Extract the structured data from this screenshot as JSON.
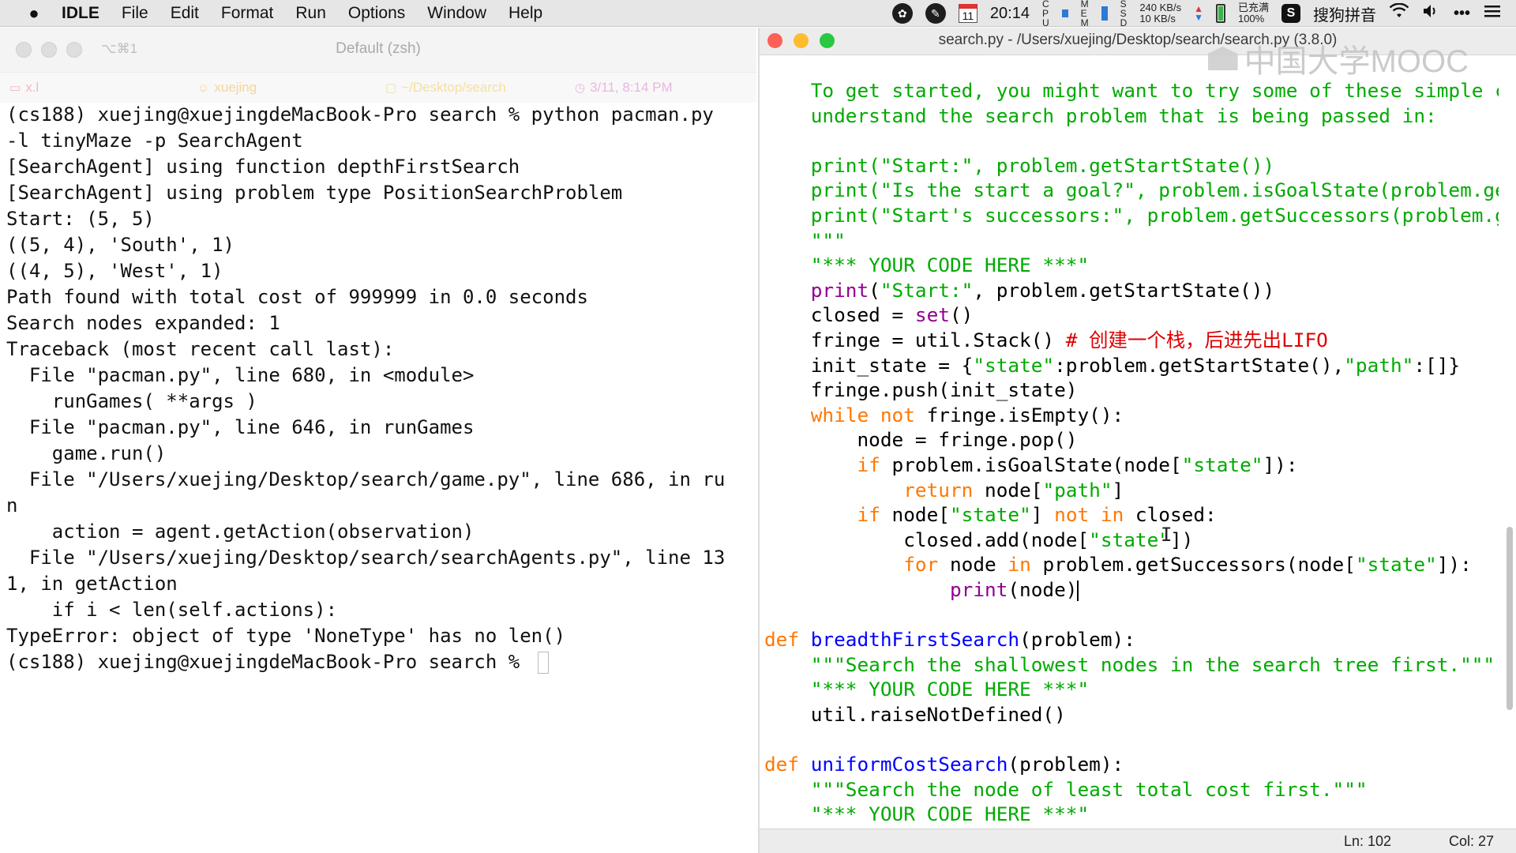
{
  "menubar": {
    "apple_icon": "apple-icon",
    "app_name": "IDLE",
    "items": [
      "File",
      "Edit",
      "Format",
      "Run",
      "Options",
      "Window",
      "Help"
    ],
    "status": {
      "calendar_day": "11",
      "time": "20:14",
      "cpu_labels": [
        "C",
        "P",
        "U"
      ],
      "mem_labels": [
        "M",
        "E",
        "M"
      ],
      "ssd_labels": [
        "S",
        "S",
        "D"
      ],
      "net_up": "240 KB/s",
      "net_down": "10 KB/s",
      "battery_status": "已充满",
      "battery_percent": "100%",
      "ime_name": "搜狗拼音"
    }
  },
  "terminal": {
    "shortcut": "⌥⌘1",
    "title": "Default (zsh)",
    "info": {
      "tab": "x.l",
      "user": "xuejing",
      "dir": "~/Desktop/search",
      "time": "3/11, 8:14 PM"
    },
    "lines": [
      "(cs188) xuejing@xuejingdeMacBook-Pro search % python pacman.py",
      "-l tinyMaze -p SearchAgent",
      "[SearchAgent] using function depthFirstSearch",
      "[SearchAgent] using problem type PositionSearchProblem",
      "Start: (5, 5)",
      "((5, 4), 'South', 1)",
      "((4, 5), 'West', 1)",
      "Path found with total cost of 999999 in 0.0 seconds",
      "Search nodes expanded: 1",
      "Traceback (most recent call last):",
      "  File \"pacman.py\", line 680, in <module>",
      "    runGames( **args )",
      "  File \"pacman.py\", line 646, in runGames",
      "    game.run()",
      "  File \"/Users/xuejing/Desktop/search/game.py\", line 686, in ru",
      "n",
      "    action = agent.getAction(observation)",
      "  File \"/Users/xuejing/Desktop/search/searchAgents.py\", line 13",
      "1, in getAction",
      "    if i < len(self.actions):",
      "TypeError: object of type 'NoneType' has no len()"
    ],
    "prompt": "(cs188) xuejing@xuejingdeMacBook-Pro search % "
  },
  "idle": {
    "title": "search.py - /Users/xuejing/Desktop/search/search.py (3.8.0)",
    "watermark": "中国大学MOOC",
    "code_lines": [
      [
        [
          "s",
          "    To get started, you might want to try some of these simple commands to"
        ]
      ],
      [
        [
          "s",
          "    understand the search problem that is being passed in:"
        ]
      ],
      [],
      [
        [
          "s",
          "    print(\"Start:\", problem.getStartState())"
        ]
      ],
      [
        [
          "s",
          "    print(\"Is the start a goal?\", problem.isGoalState(problem.getStartState()))"
        ]
      ],
      [
        [
          "s",
          "    print(\"Start's successors:\", problem.getSuccessors(problem.getStartState()))"
        ]
      ],
      [
        [
          "s",
          "    \"\"\""
        ]
      ],
      [
        [
          "s",
          "    \"*** YOUR CODE HERE ***\""
        ]
      ],
      [
        [
          "b",
          "    print"
        ],
        [
          "n",
          "("
        ],
        [
          "s",
          "\"Start:\""
        ],
        [
          "n",
          ", problem.getStartState())"
        ]
      ],
      [
        [
          "n",
          "    closed = "
        ],
        [
          "b",
          "set"
        ],
        [
          "n",
          "()"
        ]
      ],
      [
        [
          "n",
          "    fringe = util.Stack() "
        ],
        [
          "c",
          "# 创建一个栈，后进先出LIFO"
        ]
      ],
      [
        [
          "n",
          "    init_state = {"
        ],
        [
          "s",
          "\"state\""
        ],
        [
          "n",
          ":problem.getStartState(),"
        ],
        [
          "s",
          "\"path\""
        ],
        [
          "n",
          ":[]}"
        ]
      ],
      [
        [
          "n",
          "    fringe.push(init_state)"
        ]
      ],
      [
        [
          "k",
          "    while not"
        ],
        [
          "n",
          " fringe.isEmpty():"
        ]
      ],
      [
        [
          "n",
          "        node = fringe.pop()"
        ]
      ],
      [
        [
          "k",
          "        if"
        ],
        [
          "n",
          " problem.isGoalState(node["
        ],
        [
          "s",
          "\"state\""
        ],
        [
          "n",
          "]):"
        ]
      ],
      [
        [
          "k",
          "            return"
        ],
        [
          "n",
          " node["
        ],
        [
          "s",
          "\"path\""
        ],
        [
          "n",
          "]"
        ]
      ],
      [
        [
          "k",
          "        if"
        ],
        [
          "n",
          " node["
        ],
        [
          "s",
          "\"state\""
        ],
        [
          "n",
          "] "
        ],
        [
          "k",
          "not in"
        ],
        [
          "n",
          " closed:"
        ]
      ],
      [
        [
          "n",
          "            closed.add(node["
        ],
        [
          "s",
          "\"state\""
        ],
        [
          "n",
          "])"
        ]
      ],
      [
        [
          "k",
          "            for"
        ],
        [
          "n",
          " node "
        ],
        [
          "k",
          "in"
        ],
        [
          "n",
          " problem.getSuccessors(node["
        ],
        [
          "s",
          "\"state\""
        ],
        [
          "n",
          "]):"
        ]
      ],
      [
        [
          "b",
          "                print"
        ],
        [
          "n",
          "(node)"
        ],
        [
          "cursor",
          ""
        ]
      ],
      [],
      [
        [
          "k",
          "def "
        ],
        [
          "d",
          "breadthFirstSearch"
        ],
        [
          "n",
          "(problem):"
        ]
      ],
      [
        [
          "s",
          "    \"\"\"Search the shallowest nodes in the search tree first.\"\"\""
        ]
      ],
      [
        [
          "s",
          "    \"*** YOUR CODE HERE ***\""
        ]
      ],
      [
        [
          "n",
          "    util.raiseNotDefined()"
        ]
      ],
      [],
      [
        [
          "k",
          "def "
        ],
        [
          "d",
          "uniformCostSearch"
        ],
        [
          "n",
          "(problem):"
        ]
      ],
      [
        [
          "s",
          "    \"\"\"Search the node of least total cost first.\"\"\""
        ]
      ],
      [
        [
          "s",
          "    \"*** YOUR CODE HERE ***\""
        ]
      ],
      [
        [
          "n",
          "    util.raiseNotDefined()"
        ]
      ]
    ],
    "status": {
      "line": "Ln: 102",
      "col": "Col: 27"
    }
  },
  "colors": {
    "string": "#00aa00",
    "keyword": "#ff7700",
    "definition": "#0000ff",
    "builtin": "#900090",
    "comment": "#dd0000"
  }
}
